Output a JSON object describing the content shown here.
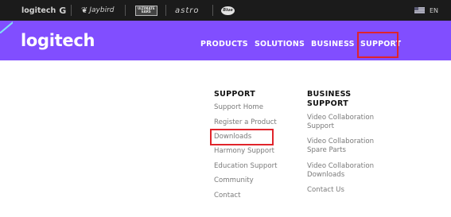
{
  "brands": {
    "logitech": "logitech",
    "logitech_g": "G",
    "jaybird": "Jaybird",
    "ultimate_ears_line1": "ULTIMATE",
    "ultimate_ears_line2": "EARS",
    "astro": "astro",
    "blue": "Blue"
  },
  "language": {
    "code": "EN",
    "flag_icon": "us-flag-icon"
  },
  "nav": {
    "logo": "logitech",
    "items": [
      "PRODUCTS",
      "SOLUTIONS",
      "BUSINESS",
      "SUPPORT"
    ]
  },
  "support_menu": {
    "heading": "SUPPORT",
    "links": [
      "Support Home",
      "Register a Product",
      "Downloads",
      "Harmony Support",
      "Education Support",
      "Community",
      "Contact"
    ]
  },
  "business_support_menu": {
    "heading_line1": "BUSINESS",
    "heading_line2": "SUPPORT",
    "links": [
      [
        "Video Collaboration",
        "Support"
      ],
      [
        "Video Collaboration",
        "Spare Parts"
      ],
      [
        "Video Collaboration",
        "Downloads"
      ],
      [
        "Contact Us"
      ]
    ]
  },
  "colors": {
    "nav_purple": "#814eff",
    "brand_bar": "#1b1b1b",
    "highlight_red": "#e0242b"
  }
}
